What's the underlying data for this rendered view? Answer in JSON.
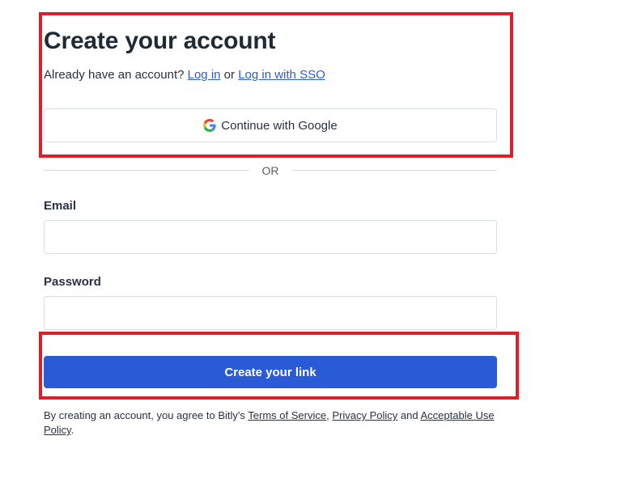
{
  "signup": {
    "title": "Create your account",
    "already_text": "Already have an account?",
    "login_link": "Log in",
    "or_word": "or",
    "sso_link": "Log in with SSO",
    "google_button": "Continue with Google",
    "divider_text": "OR",
    "email_label": "Email",
    "email_value": "",
    "password_label": "Password",
    "password_value": "",
    "submit_button": "Create your link"
  },
  "legal": {
    "prefix": "By creating an account, you agree to Bitly's",
    "terms": "Terms of Service",
    "comma": ",",
    "privacy": "Privacy Policy",
    "and": "and",
    "aup": "Acceptable Use Policy",
    "period": "."
  },
  "colors": {
    "accent": "#2a5bd7",
    "highlight_border": "#dc1f2b",
    "text": "#273144"
  },
  "icons": {
    "google": "google-icon"
  }
}
